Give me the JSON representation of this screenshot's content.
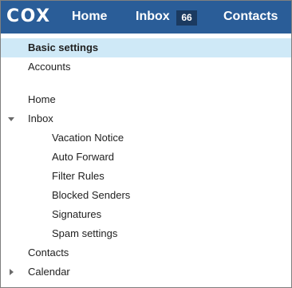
{
  "header": {
    "logo_text": "COX",
    "nav": {
      "home": "Home",
      "inbox": "Inbox",
      "inbox_count": "66",
      "contacts": "Contacts"
    }
  },
  "menu": {
    "basic_settings": "Basic settings",
    "accounts": "Accounts",
    "home": "Home",
    "inbox": "Inbox",
    "inbox_expanded": true,
    "inbox_children": {
      "vacation_notice": "Vacation Notice",
      "auto_forward": "Auto Forward",
      "filter_rules": "Filter Rules",
      "blocked_senders": "Blocked Senders",
      "signatures": "Signatures",
      "spam_settings": "Spam settings"
    },
    "contacts": "Contacts",
    "calendar": "Calendar",
    "calendar_expanded": false,
    "selected": "basic_settings"
  },
  "colors": {
    "header_bg": "#2a5d98",
    "badge_bg": "#1b3a60",
    "selected_bg": "#cfe9f7"
  },
  "icons": {
    "expanded": "caret-down-icon",
    "collapsed": "caret-right-icon"
  }
}
